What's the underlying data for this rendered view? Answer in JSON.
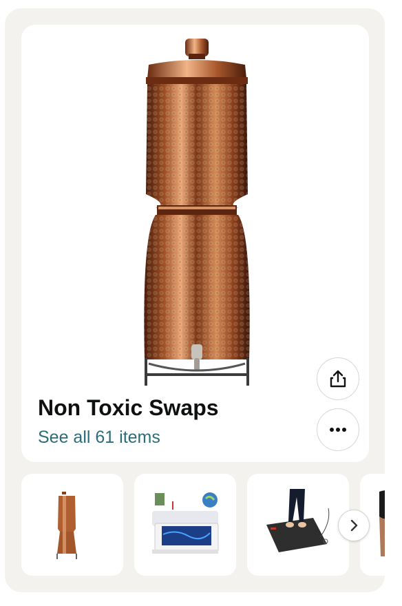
{
  "list": {
    "title": "Non Toxic Swaps",
    "see_all_label": "See all 61 items"
  },
  "hero": {
    "image": "copper-water-dispenser-image"
  },
  "actions": {
    "share_icon": "share-icon",
    "more_icon": "more-options-icon"
  },
  "thumbnails": [
    {
      "image": "copper-water-dispenser-image"
    },
    {
      "image": "grounding-mattress-pad-image"
    },
    {
      "image": "grounding-floor-mat-image"
    },
    {
      "image": "clothing-item-image"
    }
  ],
  "carousel": {
    "next_icon": "chevron-right-icon"
  },
  "colors": {
    "link": "#2a6d78",
    "title": "#0f1111",
    "panel": "#f3f2ee",
    "copper": "#b8673a"
  }
}
